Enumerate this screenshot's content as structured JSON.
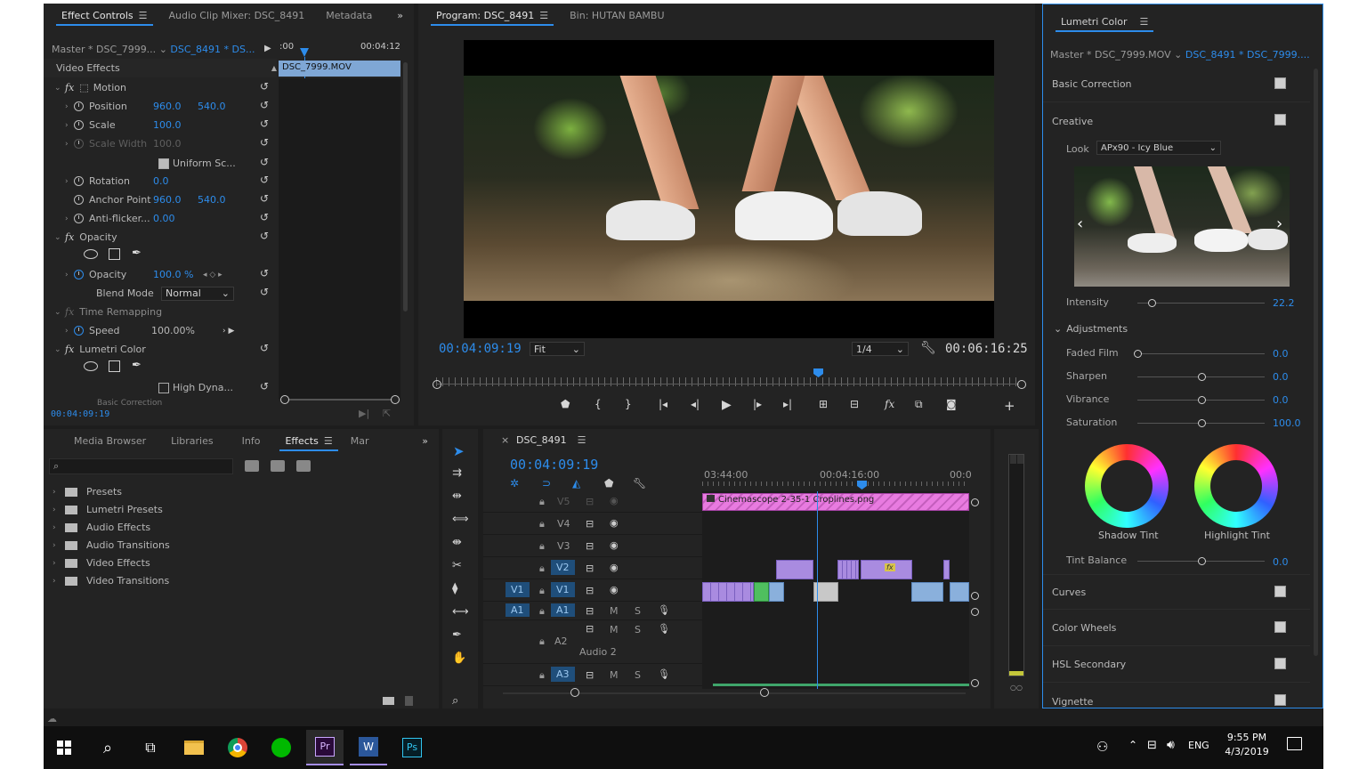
{
  "effect_controls": {
    "tabs": [
      "Effect Controls",
      "Audio Clip Mixer: DSC_8491",
      "Metadata"
    ],
    "master_label": "Master * DSC_7999...",
    "clip_label": "DSC_8491 * DS...",
    "time_start": ":00",
    "time_end": "00:04:12",
    "clip_bar": "DSC_7999.MOV",
    "video_effects": "Video Effects",
    "motion": "Motion",
    "position_label": "Position",
    "position_x": "960.0",
    "position_y": "540.0",
    "scale_label": "Scale",
    "scale_val": "100.0",
    "scale_width_label": "Scale Width",
    "scale_width_val": "100.0",
    "uniform_scale": "Uniform Sc...",
    "rotation_label": "Rotation",
    "rotation_val": "0.0",
    "anchor_label": "Anchor Point",
    "anchor_x": "960.0",
    "anchor_y": "540.0",
    "antiflicker_label": "Anti-flicker...",
    "antiflicker_val": "0.00",
    "opacity_group": "Opacity",
    "opacity_label": "Opacity",
    "opacity_val": "100.0 %",
    "blend_label": "Blend Mode",
    "blend_val": "Normal",
    "time_remap": "Time Remapping",
    "speed_label": "Speed",
    "speed_val": "100.00%",
    "lumetri": "Lumetri Color",
    "high_dyn": "High Dyna...",
    "basic_corr": "Basic Correction",
    "timecode": "00:04:09:19"
  },
  "program": {
    "tabs": [
      "Program: DSC_8491",
      "Bin: HUTAN BAMBU"
    ],
    "timecode": "00:04:09:19",
    "fit": "Fit",
    "resolution": "1/4",
    "duration": "00:06:16:25",
    "playhead_fraction": 0.655
  },
  "project": {
    "tabs": [
      "Media Browser",
      "Libraries",
      "Info",
      "Effects",
      "Mar"
    ],
    "items": [
      "Presets",
      "Lumetri Presets",
      "Audio Effects",
      "Audio Transitions",
      "Video Effects",
      "Video Transitions"
    ]
  },
  "timeline": {
    "name": "DSC_8491",
    "timecode": "00:04:09:19",
    "ruler": [
      "03:44:00",
      "00:04:16:00",
      "00:0"
    ],
    "tracks": [
      "V5",
      "V4",
      "V3",
      "V2",
      "V1",
      "A1",
      "A2",
      "A3"
    ],
    "src_v1": "V1",
    "src_a1": "A1",
    "m": "M",
    "s": "S",
    "audio2": "Audio 2",
    "title_clip": "Cinemascope 2-35-1 Croplines.png",
    "fx_badge": "fx"
  },
  "lumetri": {
    "title": "Lumetri Color",
    "master_label": "Master * DSC_7999.MOV",
    "clip_label": "DSC_8491 * DSC_7999....",
    "basic_correction": "Basic Correction",
    "creative": "Creative",
    "look_label": "Look",
    "look_val": "APx90 - Icy Blue",
    "intensity_label": "Intensity",
    "intensity_val": "22.2",
    "adjustments": "Adjustments",
    "faded_label": "Faded Film",
    "faded_val": "0.0",
    "sharpen_label": "Sharpen",
    "sharpen_val": "0.0",
    "vibrance_label": "Vibrance",
    "vibrance_val": "0.0",
    "saturation_label": "Saturation",
    "saturation_val": "100.0",
    "shadow_tint": "Shadow Tint",
    "highlight_tint": "Highlight Tint",
    "tint_label": "Tint Balance",
    "tint_val": "0.0",
    "curves": "Curves",
    "color_wheels": "Color Wheels",
    "hsl": "HSL Secondary",
    "vignette": "Vignette"
  },
  "taskbar": {
    "lang": "ENG",
    "time": "9:55 PM",
    "date": "4/3/2019",
    "pr": "Pr",
    "ps": "Ps",
    "w": "W"
  }
}
